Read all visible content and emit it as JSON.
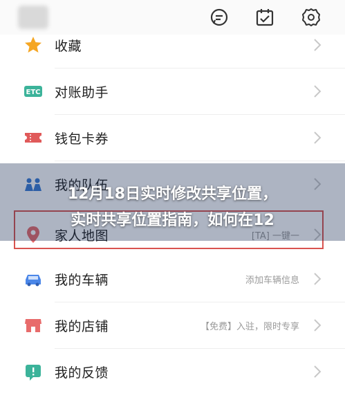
{
  "menu": {
    "items": [
      {
        "label": "收藏",
        "hint": ""
      },
      {
        "label": "对账助手",
        "hint": ""
      },
      {
        "label": "钱包卡券",
        "hint": ""
      },
      {
        "label": "我的队伍",
        "hint": ""
      },
      {
        "label": "家人地图",
        "hint": "[TA] 一键一"
      },
      {
        "label": "我的车辆",
        "hint": "添加车辆信息"
      },
      {
        "label": "我的店铺",
        "hint": "【免费】入驻，限时专享"
      },
      {
        "label": "我的反馈",
        "hint": ""
      }
    ]
  },
  "overlay": {
    "line1": "12月18日实时修改共享位置，",
    "line2": "实时共享位置指南，如何在12"
  },
  "colors": {
    "star": "#f5a623",
    "etc": "#3cb39a",
    "ticket": "#e05a5a",
    "team": "#3a7bd5",
    "map": "#e86b6b",
    "car": "#4a86e8",
    "shop": "#e86b6b",
    "feedback": "#3cb39a",
    "highlight": "#d9534f"
  }
}
